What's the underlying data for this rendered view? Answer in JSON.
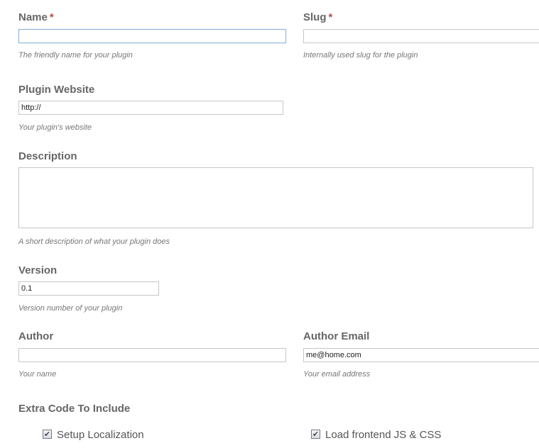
{
  "name": {
    "label": "Name",
    "required_mark": "*",
    "value": "",
    "hint": "The friendly name for your plugin"
  },
  "slug": {
    "label": "Slug",
    "required_mark": "*",
    "value": "",
    "hint": "Internally used slug for the plugin"
  },
  "website": {
    "label": "Plugin Website",
    "value": "http://",
    "hint": "Your plugin's website"
  },
  "description": {
    "label": "Description",
    "value": "",
    "hint": "A short description of what your plugin does"
  },
  "version": {
    "label": "Version",
    "value": "0.1",
    "hint": "Version number of your plugin"
  },
  "author": {
    "label": "Author",
    "value": "",
    "hint": "Your name"
  },
  "author_email": {
    "label": "Author Email",
    "value": "me@home.com",
    "hint": "Your email address"
  },
  "extra_code": {
    "label": "Extra Code To Include",
    "options": [
      {
        "label": "Setup Localization",
        "checked": true
      },
      {
        "label": "Load frontend JS & CSS",
        "checked": true
      }
    ]
  },
  "colors": {
    "label": "#666666",
    "required": "#b94a48",
    "hint": "#777777",
    "input_border": "#c7c7c7",
    "focus_border": "#8ab4dd"
  },
  "icons": {
    "checkbox": "check-mark"
  }
}
